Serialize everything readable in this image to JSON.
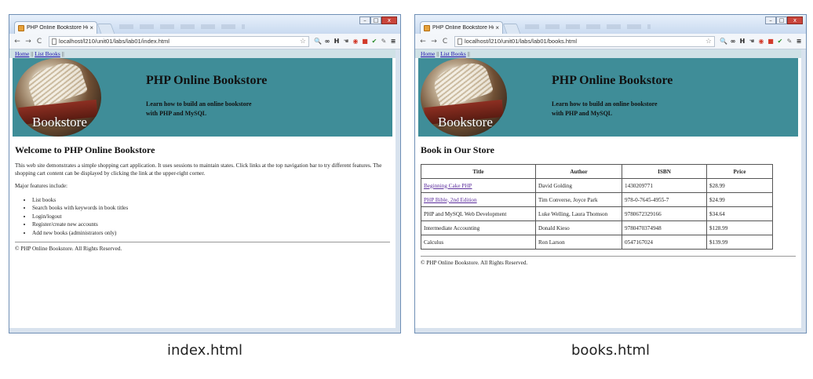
{
  "left_window": {
    "tab_title": "PHP Online Bookstore Ho",
    "tab_close": "×",
    "url": "localhost/l210/unit01/labs/lab01/index.html",
    "nav": {
      "home": "Home",
      "list_books": "List Books",
      "sep": "||"
    },
    "banner": {
      "title": "PHP Online Bookstore",
      "subtitle_line1": "Learn how to build an online bookstore",
      "subtitle_line2": "with PHP and MySQL",
      "logo_text": "Bookstore"
    },
    "heading": "Welcome to PHP Online Bookstore",
    "intro": "This web site demonstrates a simple shopping cart application. It uses sessions to maintain states. Click links at the top navigation bar to try different features. The shopping cart content can be displayed by clicking the link at the upper-right corner.",
    "features_label": "Major features include:",
    "features": [
      "List books",
      "Search books with keywords in book titles",
      "Login/logout",
      "Register/create new accounts",
      "Add new books (administrators only)"
    ],
    "footer": "© PHP Online Bookstore. All Rights Reserved."
  },
  "right_window": {
    "tab_title": "PHP Online Bookstore Ho",
    "tab_close": "×",
    "url": "localhost/l210/unit01/labs/lab01/books.html",
    "nav": {
      "home": "Home",
      "list_books": "List Books",
      "sep": "||"
    },
    "banner": {
      "title": "PHP Online Bookstore",
      "subtitle_line1": "Learn how to build an online bookstore",
      "subtitle_line2": "with PHP and MySQL",
      "logo_text": "Bookstore"
    },
    "heading": "Book in Our Store",
    "table": {
      "headers": [
        "Title",
        "Author",
        "ISBN",
        "Price"
      ],
      "rows": [
        [
          "Beginning Cake PHP",
          "David Golding",
          "1430209771",
          "$28.99"
        ],
        [
          "PHP Bible, 2nd Edition",
          "Tim Converse, Joyce Park",
          "978-0-7645-4955-7",
          "$24.99"
        ],
        [
          "PHP and MySQL Web Development",
          "Luke Welling, Laura Thomson",
          "9780672329166",
          "$34.64"
        ],
        [
          "Intermediate Accounting",
          "Donald Kieso",
          "9780470374948",
          "$128.99"
        ],
        [
          "Calculus",
          "Ron Larson",
          "0547167024",
          "$139.99"
        ]
      ]
    },
    "footer": "© PHP Online Bookstore. All Rights Reserved."
  },
  "captions": {
    "left": "index.html",
    "right": "books.html"
  },
  "toolbar_icons": {
    "back": "←",
    "forward": "→",
    "reload": "C",
    "star": "☆",
    "ext_h": "H",
    "menu": "≡"
  },
  "window_buttons": {
    "minimize": "–",
    "maximize": "□",
    "close": "x"
  },
  "colors": {
    "banner": "#3f8d98",
    "navbar": "#cfe1e6",
    "link": "#1a0dab",
    "visited_link": "#5b2d9c"
  }
}
